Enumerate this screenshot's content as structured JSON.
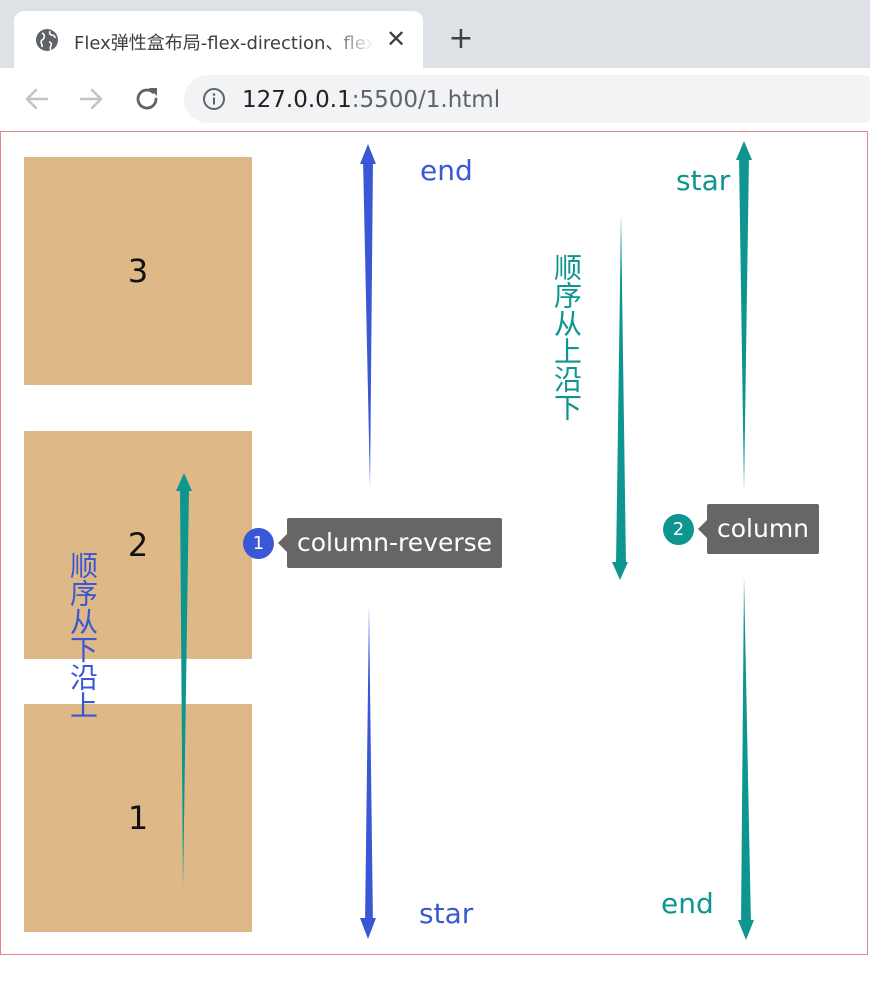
{
  "browser": {
    "tab": {
      "title": "Flex弹性盒布局-flex-direction、flex",
      "close_glyph": "✕",
      "favicon_icon": "globe-icon"
    },
    "new_tab_glyph": "+",
    "nav": {
      "back_icon": "arrow-left-icon",
      "forward_icon": "arrow-right-icon",
      "reload_icon": "reload-icon"
    },
    "address": {
      "host": "127.0.0.1",
      "rest": ":5500/1.html",
      "info_icon": "info-icon"
    }
  },
  "page": {
    "boxes": [
      {
        "label": "3"
      },
      {
        "label": "2"
      },
      {
        "label": "1"
      }
    ],
    "left_group": {
      "end_label": "end",
      "start_label": "star",
      "order_text": "顺序从下沿上",
      "callout": {
        "badge": "1",
        "text": "column-reverse"
      }
    },
    "right_group": {
      "start_label": "star",
      "end_label": "end",
      "order_text": "顺序从上沿下",
      "callout": {
        "badge": "2",
        "text": "column"
      }
    }
  },
  "colors": {
    "box": "#deb887",
    "blue_annotation": "#3a58d6",
    "teal_annotation": "#0e958f",
    "callout_bg": "#666666",
    "page_border": "#e8868e"
  }
}
